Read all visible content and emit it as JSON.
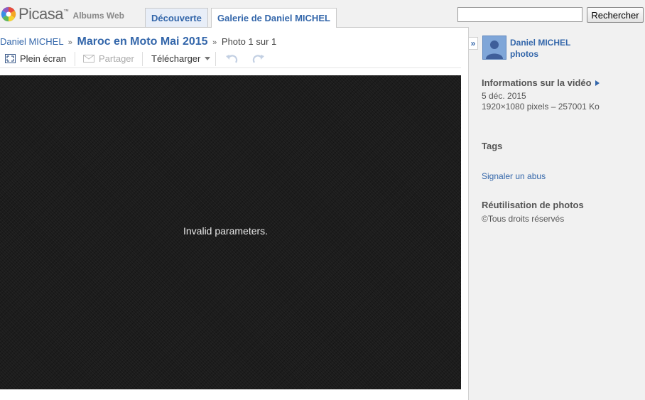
{
  "brand": {
    "name": "Picasa",
    "tm": "™",
    "subtitle": "Albums Web"
  },
  "tabs": [
    {
      "label": "Découverte",
      "active": false
    },
    {
      "label": "Galerie de Daniel MICHEL",
      "active": true
    }
  ],
  "search": {
    "value": "",
    "button_label": "Rechercher"
  },
  "breadcrumb": {
    "owner": "Daniel MICHEL",
    "separator": "»",
    "album": "Maroc en Moto Mai 2015",
    "position": "Photo 1 sur 1"
  },
  "toolbar": {
    "fullscreen": "Plein écran",
    "share": "Partager",
    "download": "Télécharger"
  },
  "photo": {
    "message": "Invalid parameters."
  },
  "sidebar": {
    "owner_name": "Daniel MICHEL",
    "owner_photos": "photos",
    "video_info_heading": "Informations sur la vidéo",
    "date": "5 déc. 2015",
    "dimensions": "1920×1080 pixels – 257001 Ko",
    "tags_heading": "Tags",
    "report_link": "Signaler un abus",
    "reuse_heading": "Réutilisation de photos",
    "copyright_symbol": "©",
    "copyright": "Tous droits réservés"
  },
  "colors": {
    "link": "#3366aa",
    "photo_bg": "#1c1c1c",
    "sidebar_bg": "#f1f1f1"
  }
}
